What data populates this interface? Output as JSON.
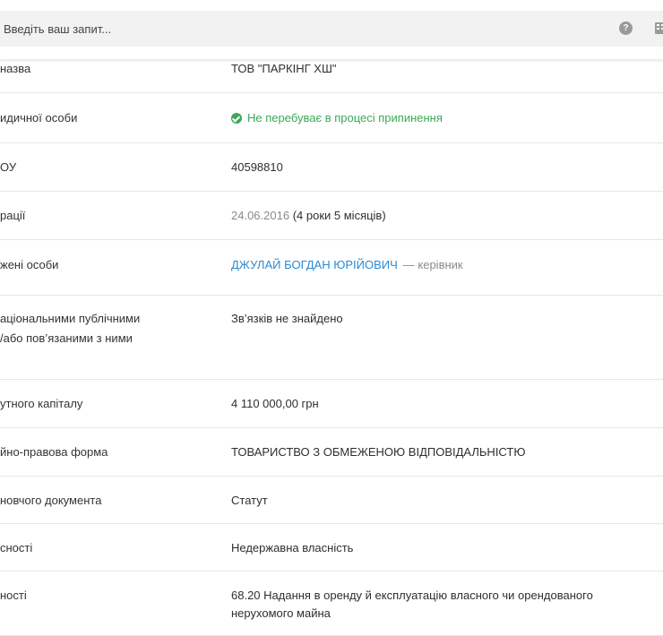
{
  "search": {
    "placeholder": "Введіть ваш запит..."
  },
  "header": {
    "help_icon": "?"
  },
  "rows": [
    {
      "label": "назва",
      "value": "ТОВ \"ПАРКІНГ ХШ\""
    },
    {
      "label": "идичної особи",
      "status": "Не перебуває в процесі припинення"
    },
    {
      "label": "ОУ",
      "value": "40598810"
    },
    {
      "label": "рації",
      "date": "24.06.2016",
      "age": "(4 роки 5 місяців)"
    },
    {
      "label": "жені особи",
      "person": "ДЖУЛАЙ БОГДАН ЮРІЙОВИЧ",
      "role": "— керівник"
    },
    {
      "label_line1": "аціональними публічними",
      "label_line2": "/або пов’язаними з ними",
      "value": "Зв’язків не знайдено"
    },
    {
      "label": "утного капіталу",
      "value": "4 110 000,00 грн"
    },
    {
      "label": "йно-правова форма",
      "value": "ТОВАРИСТВО З ОБМЕЖЕНОЮ ВІДПОВІДАЛЬНІСТЮ"
    },
    {
      "label": "новчого документа",
      "value": "Статут"
    },
    {
      "label": "сності",
      "value": "Недержавна власність"
    },
    {
      "label": "ності",
      "value_line1": "68.20 Надання в оренду й експлуатацію власного чи орендованого",
      "value_line2": "нерухомого майна"
    }
  ]
}
